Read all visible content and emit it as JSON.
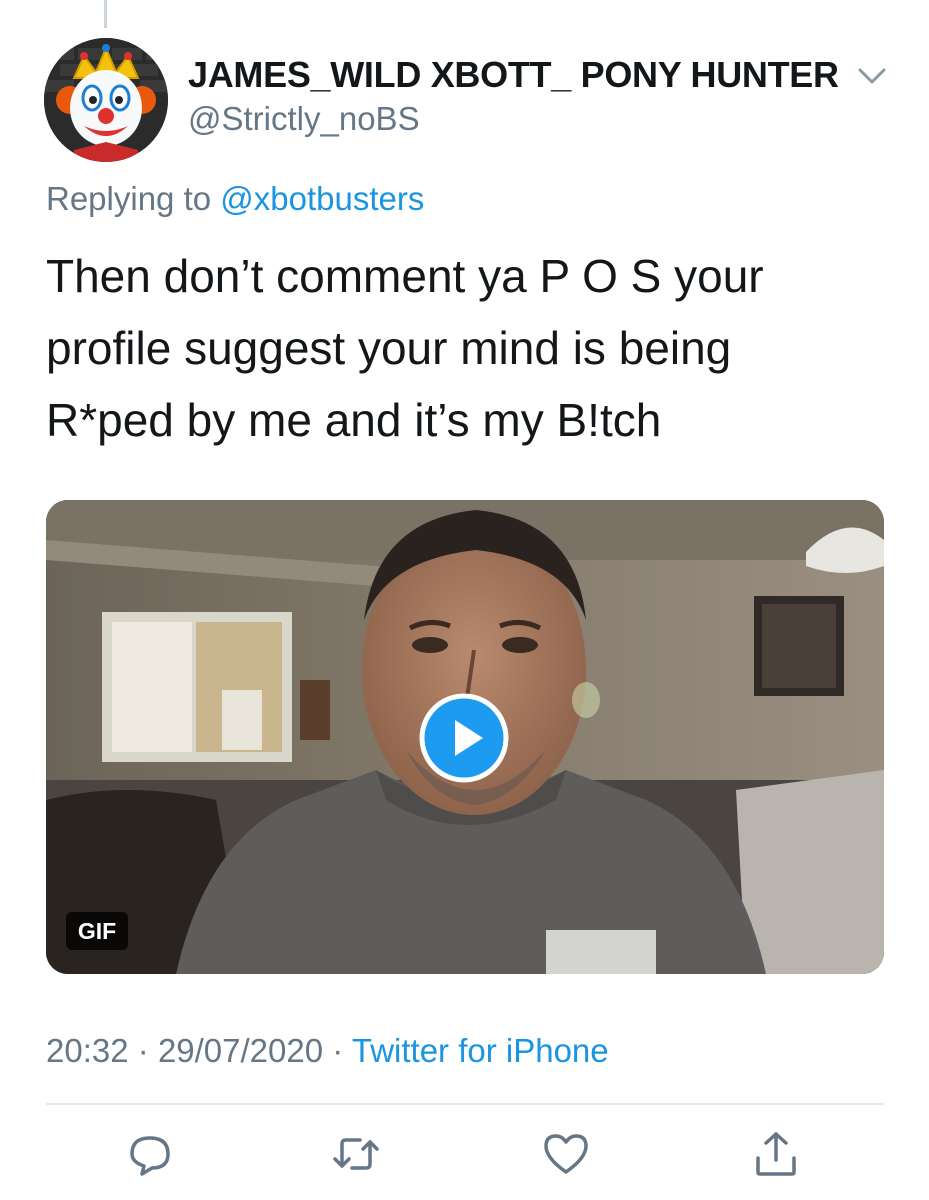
{
  "tweet": {
    "display_name": "JAMES_WILD XBOTT_ PONY HUNTER",
    "handle": "@Strictly_noBS",
    "replying_prefix": "Replying to",
    "replying_to": "@xbotbusters",
    "text_lines": [
      "Then don’t comment ya P O S your",
      "profile suggest your mind is being",
      "R*ped by me and it’s my B!tch"
    ],
    "media": {
      "badge": "GIF",
      "play_icon": "play-icon"
    },
    "time": "20:32",
    "separator": "·",
    "date": "29/07/2020",
    "source": "Twitter for iPhone"
  },
  "actions": [
    {
      "name": "reply-icon"
    },
    {
      "name": "retweet-icon"
    },
    {
      "name": "like-icon"
    },
    {
      "name": "share-icon"
    }
  ],
  "colors": {
    "link": "#1b95e0",
    "secondary_text": "#657786",
    "primary_text": "#14171a",
    "divider": "#e1e8ed"
  }
}
